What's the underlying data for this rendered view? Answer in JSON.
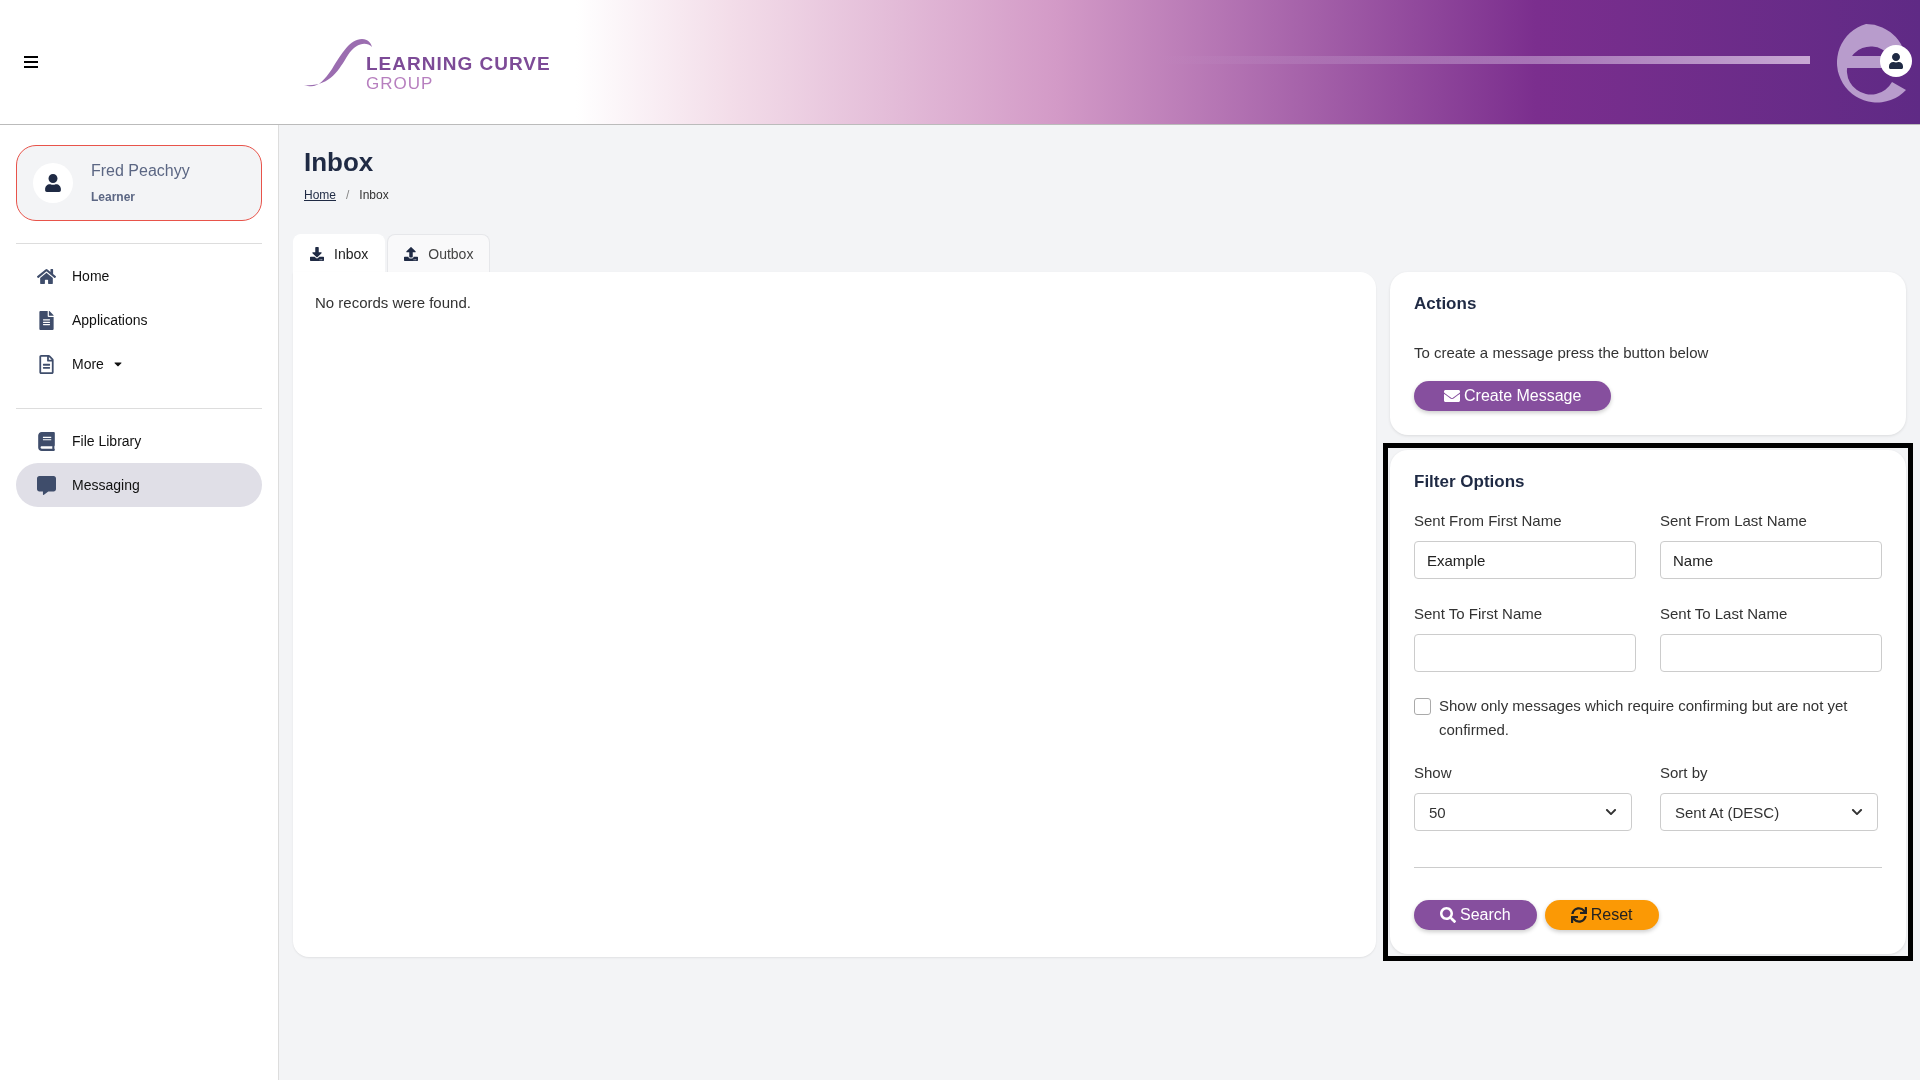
{
  "header": {
    "logo": {
      "line_1": "LEARNING CURVE",
      "line_2": "GROUP"
    }
  },
  "user": {
    "name": "Fred Peachyy",
    "role": "Learner"
  },
  "sidebar": {
    "groups": [
      [
        {
          "label": "Home",
          "selected": false,
          "dropdown": false
        },
        {
          "label": "Applications",
          "selected": false,
          "dropdown": false
        },
        {
          "label": "More",
          "selected": false,
          "dropdown": true
        }
      ],
      [
        {
          "label": "File Library",
          "selected": false,
          "dropdown": false
        },
        {
          "label": "Messaging",
          "selected": true,
          "dropdown": false
        }
      ]
    ]
  },
  "page": {
    "title": "Inbox",
    "breadcrumb": [
      {
        "label": "Home",
        "kind": "link"
      },
      {
        "label": "/",
        "kind": "separator"
      },
      {
        "label": "Inbox",
        "kind": "current"
      }
    ]
  },
  "tabs": [
    {
      "label": "Inbox",
      "selected": true
    },
    {
      "label": "Outbox",
      "selected": false
    }
  ],
  "messages": {
    "empty_text": "No records were found."
  },
  "actions": {
    "title": "Actions",
    "text": "To create a message press the button below",
    "button": "Create Message"
  },
  "filter": {
    "title": "Filter Options",
    "highlighted": true,
    "fields": [
      {
        "label": "Sent From First Name",
        "value": "Example"
      },
      {
        "label": "Sent From Last Name",
        "value": "Name"
      },
      {
        "label": "Sent To First Name"
      },
      {
        "label": "Sent To Last Name"
      }
    ],
    "confirm_checkbox": {
      "label": "Show only messages which require confirming but are not yet confirmed.",
      "checked": false
    },
    "selects": [
      {
        "label": "Show",
        "value": "50"
      },
      {
        "label": "Sort by",
        "value": "Sent At (DESC)"
      }
    ],
    "buttons": [
      {
        "label": "Search",
        "kind": "search"
      },
      {
        "label": "Reset",
        "kind": "reset"
      }
    ]
  }
}
